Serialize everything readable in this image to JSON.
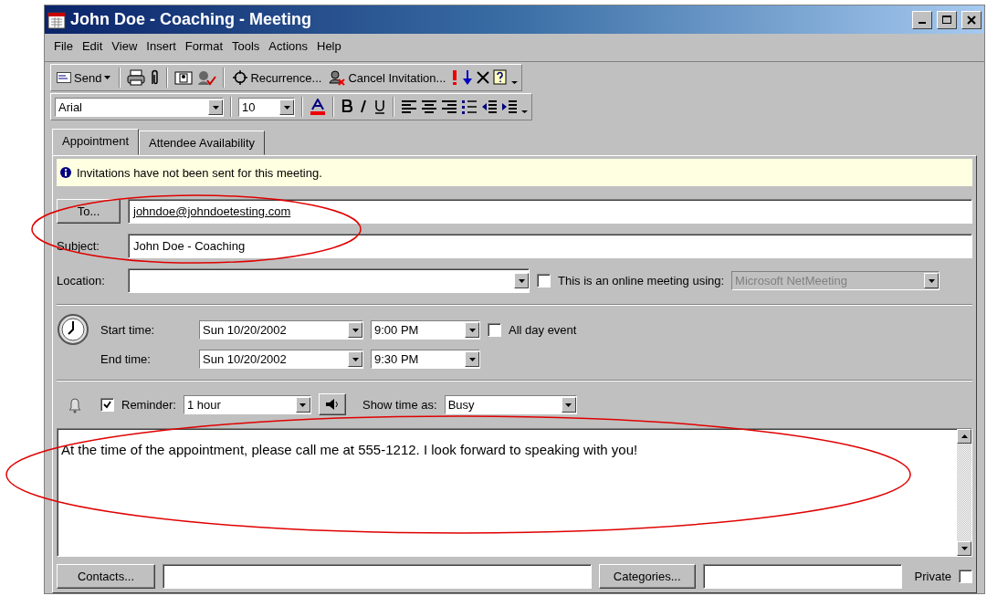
{
  "window": {
    "title": "John Doe - Coaching - Meeting"
  },
  "menu": [
    "File",
    "Edit",
    "View",
    "Insert",
    "Format",
    "Tools",
    "Actions",
    "Help"
  ],
  "standard_toolbar": {
    "send": "Send",
    "recurrence": "Recurrence...",
    "cancel_invitation": "Cancel Invitation..."
  },
  "format_toolbar": {
    "font": "Arial",
    "size": "10"
  },
  "tabs": [
    {
      "label": "Appointment",
      "selected": true
    },
    {
      "label": "Attendee Availability",
      "selected": false
    }
  ],
  "info_bar": "Invitations have not been sent for this meeting.",
  "to": {
    "button": "To...",
    "value": "johndoe@johndoetesting.com"
  },
  "subject": {
    "label": "Subject:",
    "value": "John Doe - Coaching"
  },
  "location": {
    "label": "Location:"
  },
  "online_meeting": {
    "label": "This is an online meeting using:",
    "checked": false,
    "program": "Microsoft NetMeeting",
    "disabled": true
  },
  "start": {
    "label": "Start time:",
    "date": "Sun 10/20/2002",
    "time": "9:00 PM"
  },
  "end": {
    "label": "End time:",
    "date": "Sun 10/20/2002",
    "time": "9:30 PM"
  },
  "all_day": {
    "label": "All day event",
    "checked": false
  },
  "reminder": {
    "label": "Reminder:",
    "checked": true,
    "value": "1 hour"
  },
  "show_time_as": {
    "label": "Show time as:",
    "value": "Busy"
  },
  "notes": "At the time of the appointment, please call me at 555-1212.  I look forward to speaking with you!",
  "bottom": {
    "contacts": "Contacts...",
    "categories": "Categories...",
    "private": {
      "label": "Private",
      "checked": false
    }
  },
  "annotations": [
    {
      "kind": "ellipse"
    },
    {
      "kind": "ellipse"
    }
  ]
}
